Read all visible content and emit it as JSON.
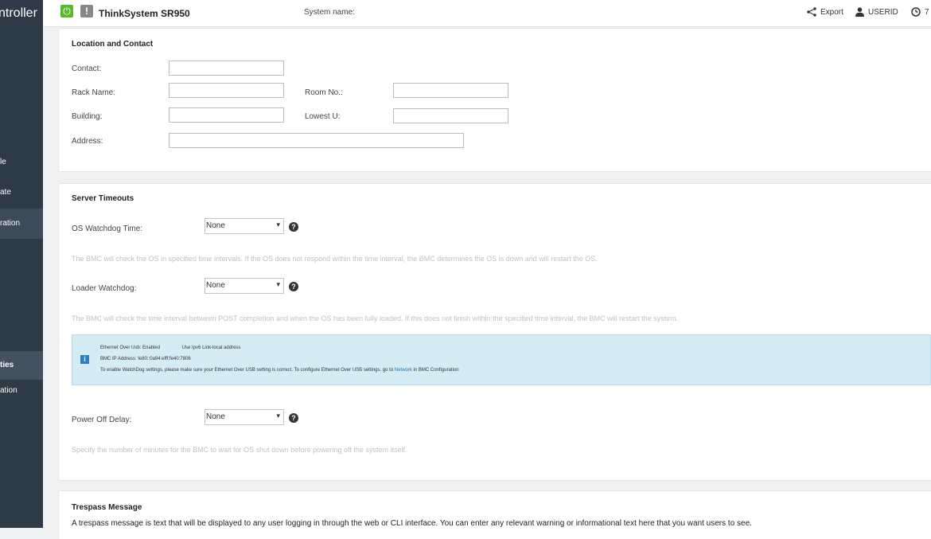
{
  "sidebar": {
    "app_title": "ntroller",
    "items": [
      {
        "label": "le"
      },
      {
        "label": "ate"
      },
      {
        "label": "ration"
      },
      {
        "label": "ties"
      },
      {
        "label": "ation"
      }
    ]
  },
  "topbar": {
    "power_icon": "power-icon",
    "warning_label": "!",
    "model": "ThinkSystem SR950",
    "system_name_label": "System name:",
    "export_label": "Export",
    "user_label": "USERID",
    "clock_value": "7"
  },
  "location": {
    "title": "Location and Contact",
    "contact_label": "Contact:",
    "rack_label": "Rack Name:",
    "room_label": "Room No.:",
    "building_label": "Building:",
    "lowest_u_label": "Lowest U:",
    "address_label": "Address:",
    "contact_value": "",
    "rack_value": "",
    "room_value": "",
    "building_value": "",
    "lowest_u_value": "",
    "address_value": ""
  },
  "timeouts": {
    "title": "Server Timeouts",
    "os_watchdog_label": "OS Watchdog Time:",
    "os_watchdog_value": "None",
    "os_watchdog_desc": "The BMC will check the OS in specified time intervals. If the OS does not respond within the time interval, the BMC determines the OS is down and will restart the OS.",
    "loader_watchdog_label": "Loader Watchdog:",
    "loader_watchdog_value": "None",
    "loader_watchdog_desc": "The BMC will check the time interval between POST completion and when the OS has been fully loaded. If this does not finish within the specified time interval, the BMC will restart the system.",
    "info": {
      "eth_over_usb": "Ethernet Over Usb: Enabled",
      "use_ipv6": "Use Ipv6 Link-local address",
      "bmc_ip": "BMC IP Address: fe80::0a94:efff:fe40:7806",
      "note_prefix": "To enable WatchDog settings, please make sure your Ethernet Over USB setting is correct. To configure Ethernet Over USB settings, go to",
      "note_link": "Network",
      "note_suffix": "in BMC Configuration"
    },
    "power_off_delay_label": "Power Off Delay:",
    "power_off_delay_value": "None",
    "power_off_delay_desc": "Specify the number of minutes for the BMC to wait for OS shut down before powering off the system itself."
  },
  "trespass": {
    "title": "Trespass Message",
    "desc": "A trespass message is text that will be displayed to any user logging in through the web or CLI interface. You can enter any relevant warning or informational text here that you want users to see."
  },
  "colors": {
    "sidebar_bg": "#2e3a46",
    "power_green": "#5cb82e",
    "info_bg": "#d6ecf5",
    "info_icon": "#2a80c4",
    "link": "#2a6fb8"
  }
}
